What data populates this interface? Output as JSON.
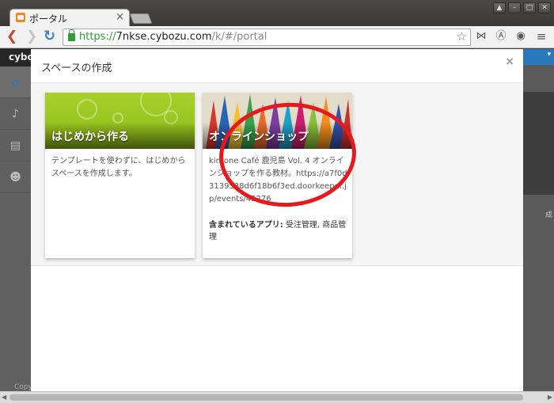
{
  "tab": {
    "title": "ポータル",
    "close": "×"
  },
  "address": {
    "scheme": "https://",
    "host": "7nkse.cybozu.com",
    "path": "/k/#/portal"
  },
  "app": {
    "brand": "cybo",
    "copyright": "Copy"
  },
  "modal": {
    "title": "スペースの作成",
    "close": "×",
    "cards": [
      {
        "title": "はじめから作る",
        "description": "テンプレートを使わずに、はじめからスペースを作成します。"
      },
      {
        "title": "オンラインショップ",
        "description": "kintone Café 鹿児島 Vol. 4 オンラインショップを作る教材。https://a7f0d3139588d6f18b6f3ed.doorkeeper.jp/events/45276",
        "apps_label": "含まれているアプリ:",
        "apps": "受注管理, 商品管理"
      }
    ]
  },
  "right_panel": {
    "text": "成"
  },
  "colors": {
    "accent": "#2a78bd",
    "annotation": "#e6191c",
    "card_green": "#9cc81f"
  }
}
